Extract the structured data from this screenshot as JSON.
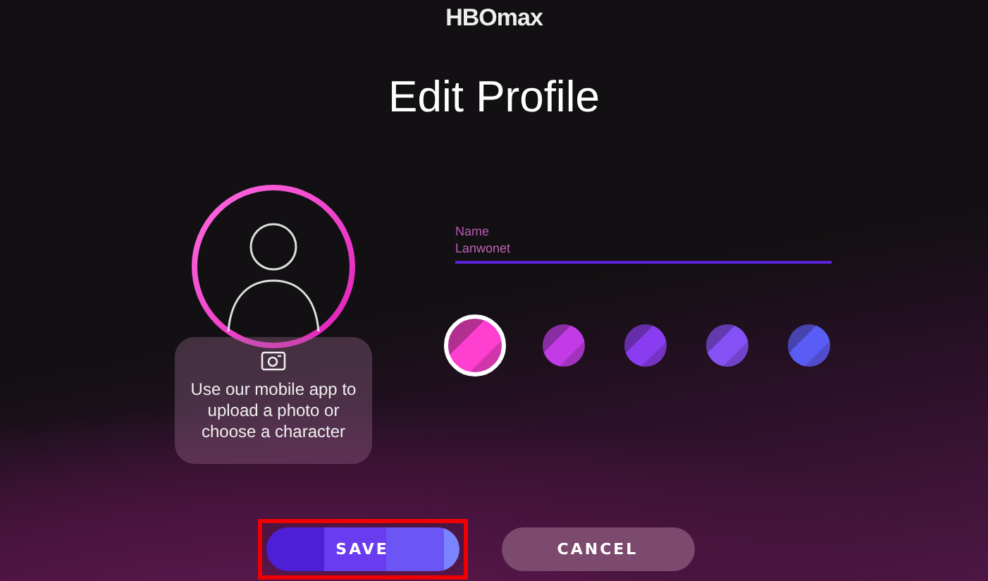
{
  "header": {
    "logo": "HBOmax"
  },
  "title": "Edit Profile",
  "photo_card": {
    "text": "Use our mobile app to upload a photo or choose a character"
  },
  "name_field": {
    "label": "Name",
    "value": "Lanwonet"
  },
  "swatches": [
    {
      "color": "#ff3fcf",
      "selected": true
    },
    {
      "color": "#c23be6",
      "selected": false
    },
    {
      "color": "#8a3cf0",
      "selected": false
    },
    {
      "color": "#8550f5",
      "selected": false
    },
    {
      "color": "#5a5cf6",
      "selected": false
    }
  ],
  "buttons": [
    {
      "label": "SAVE",
      "kind": "primary",
      "highlighted": true
    },
    {
      "label": "CANCEL",
      "kind": "secondary",
      "highlighted": false
    }
  ]
}
